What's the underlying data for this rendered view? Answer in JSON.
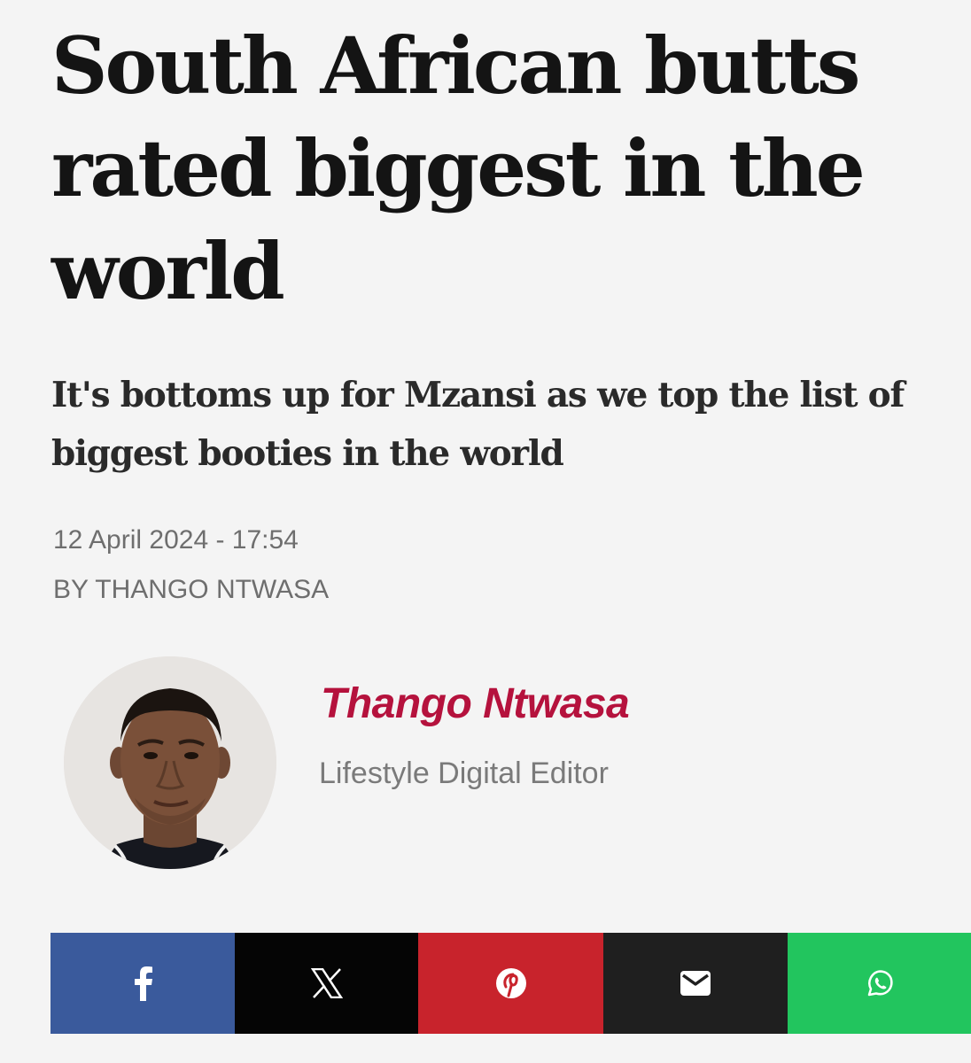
{
  "article": {
    "headline": "South African butts rated biggest in the world",
    "subheadline": "It's bottoms up for Mzansi as we top the list of biggest booties in the world",
    "date": "12 April 2024 - 17:54",
    "byline": "BY THANGO NTWASA"
  },
  "author": {
    "name": "Thango Ntwasa",
    "role": "Lifestyle Digital Editor",
    "name_color": "#b5123d"
  },
  "share": {
    "buttons": [
      {
        "icon": "facebook-icon",
        "color": "#3a5a9c"
      },
      {
        "icon": "x-icon",
        "color": "#050505"
      },
      {
        "icon": "pinterest-icon",
        "color": "#c8232c"
      },
      {
        "icon": "email-icon",
        "color": "#1f1f1f"
      },
      {
        "icon": "whatsapp-icon",
        "color": "#22c55e"
      }
    ]
  }
}
